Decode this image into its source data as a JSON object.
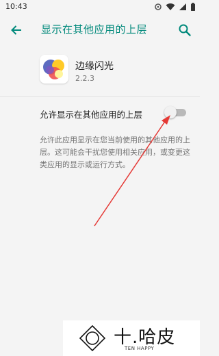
{
  "status_bar": {
    "time": "10:43",
    "icons": [
      "settings-icon",
      "wifi-icon",
      "signal-icon",
      "battery-icon"
    ]
  },
  "toolbar": {
    "title": "显示在其他应用的上层",
    "back_icon": "arrow-back-icon",
    "search_icon": "search-icon",
    "title_color": "#00897b"
  },
  "app": {
    "name": "边缘闪光",
    "version": "2.2.3"
  },
  "permission": {
    "label": "允许显示在其他应用的上层",
    "enabled": false
  },
  "description": "允许此应用显示在您当前使用的其他应用的上层。这可能会干扰您使用相关应用，或变更这类应用的显示或运行方式。",
  "watermark": {
    "title": "十.哈皮",
    "subtitle": "TEN HAPPY"
  },
  "annotation": {
    "arrow_color": "#e53935"
  }
}
